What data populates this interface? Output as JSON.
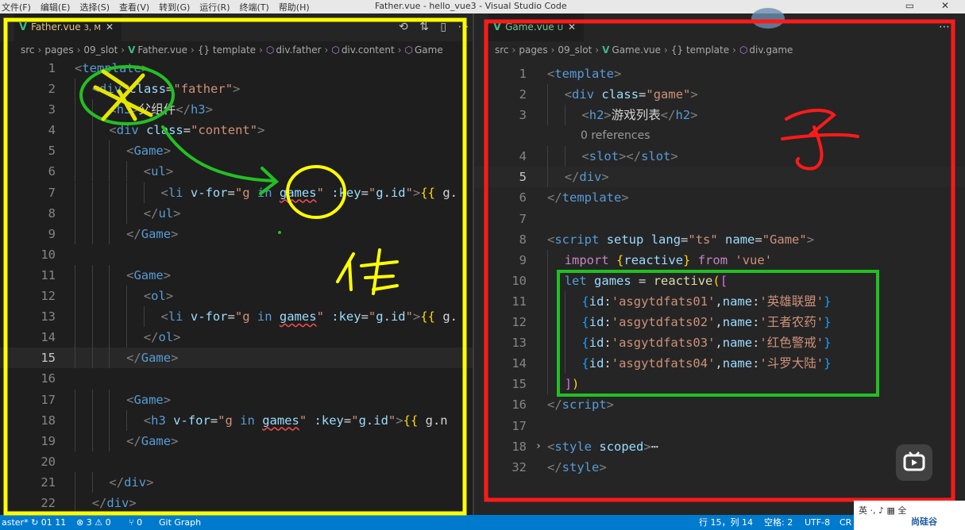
{
  "window": {
    "menu": [
      "文件(F)",
      "编辑(E)",
      "选择(S)",
      "查看(V)",
      "转到(G)",
      "运行(R)",
      "终端(T)",
      "帮助(H)"
    ],
    "title": "Father.vue - hello_vue3 - Visual Studio Code",
    "controls": [
      "▭",
      "✕"
    ]
  },
  "left": {
    "tab": {
      "name": "Father.vue",
      "status": "3, M",
      "close": "✕"
    },
    "actions": [
      "⟲",
      "⇅",
      "▯",
      "⋯"
    ],
    "breadcrumb": [
      "src",
      "pages",
      "09_slot",
      "Father.vue",
      "{} template",
      "div.father",
      "div.content",
      "Game"
    ],
    "lines": [
      {
        "n": "1",
        "tokens": [
          [
            "t-punct",
            "<"
          ],
          [
            "t-tag",
            "template"
          ],
          [
            "t-punct",
            ">"
          ]
        ],
        "indent": 0
      },
      {
        "n": "2",
        "tokens": [
          [
            "t-punct",
            "<"
          ],
          [
            "t-tag",
            "div"
          ],
          [
            "t-text",
            " "
          ],
          [
            "t-attr",
            "class"
          ],
          [
            "t-text",
            "="
          ],
          [
            "t-str",
            "\"father\""
          ],
          [
            "t-punct",
            ">"
          ]
        ],
        "indent": 1
      },
      {
        "n": "3",
        "tokens": [
          [
            "t-punct",
            "<"
          ],
          [
            "t-tag",
            "h3"
          ],
          [
            "t-punct",
            ">"
          ],
          [
            "t-text",
            "父组件"
          ],
          [
            "t-punct",
            "</"
          ],
          [
            "t-tag",
            "h3"
          ],
          [
            "t-punct",
            ">"
          ]
        ],
        "indent": 2
      },
      {
        "n": "4",
        "tokens": [
          [
            "t-punct",
            "<"
          ],
          [
            "t-tag",
            "div"
          ],
          [
            "t-text",
            " "
          ],
          [
            "t-attr",
            "class"
          ],
          [
            "t-text",
            "="
          ],
          [
            "t-str",
            "\"content\""
          ],
          [
            "t-punct",
            ">"
          ]
        ],
        "indent": 2
      },
      {
        "n": "5",
        "tokens": [
          [
            "t-punct",
            "<"
          ],
          [
            "t-tag",
            "Game"
          ],
          [
            "t-punct",
            ">"
          ]
        ],
        "indent": 3
      },
      {
        "n": "6",
        "tokens": [
          [
            "t-punct",
            "<"
          ],
          [
            "t-tag",
            "ul"
          ],
          [
            "t-punct",
            ">"
          ]
        ],
        "indent": 4
      },
      {
        "n": "7",
        "tokens": [
          [
            "t-punct",
            "<"
          ],
          [
            "t-tag",
            "li"
          ],
          [
            "t-text",
            " "
          ],
          [
            "t-attr",
            "v-for"
          ],
          [
            "t-text",
            "="
          ],
          [
            "t-str",
            "\"g "
          ],
          [
            "t-kw",
            "in"
          ],
          [
            "t-text",
            " "
          ],
          [
            "t-var t-err",
            "games"
          ],
          [
            "t-str",
            "\""
          ],
          [
            "t-text",
            " "
          ],
          [
            "t-attr",
            ":key"
          ],
          [
            "t-text",
            "="
          ],
          [
            "t-str",
            "\""
          ],
          [
            "t-var",
            "g"
          ],
          [
            "t-text",
            "."
          ],
          [
            "t-var",
            "id"
          ],
          [
            "t-str",
            "\""
          ],
          [
            "t-punct",
            ">"
          ],
          [
            "t-brace",
            "{{"
          ],
          [
            "t-text",
            " g."
          ]
        ],
        "indent": 5
      },
      {
        "n": "8",
        "tokens": [
          [
            "t-punct",
            "</"
          ],
          [
            "t-tag",
            "ul"
          ],
          [
            "t-punct",
            ">"
          ]
        ],
        "indent": 4
      },
      {
        "n": "9",
        "tokens": [
          [
            "t-punct",
            "</"
          ],
          [
            "t-tag",
            "Game"
          ],
          [
            "t-punct",
            ">"
          ]
        ],
        "indent": 3
      },
      {
        "n": "10",
        "tokens": [],
        "indent": 0
      },
      {
        "n": "11",
        "tokens": [
          [
            "t-punct",
            "<"
          ],
          [
            "t-tag",
            "Game"
          ],
          [
            "t-punct",
            ">"
          ]
        ],
        "indent": 3
      },
      {
        "n": "12",
        "tokens": [
          [
            "t-punct",
            "<"
          ],
          [
            "t-tag",
            "ol"
          ],
          [
            "t-punct",
            ">"
          ]
        ],
        "indent": 4
      },
      {
        "n": "13",
        "tokens": [
          [
            "t-punct",
            "<"
          ],
          [
            "t-tag",
            "li"
          ],
          [
            "t-text",
            " "
          ],
          [
            "t-attr",
            "v-for"
          ],
          [
            "t-text",
            "="
          ],
          [
            "t-str",
            "\"g "
          ],
          [
            "t-kw",
            "in"
          ],
          [
            "t-text",
            " "
          ],
          [
            "t-var t-err",
            "games"
          ],
          [
            "t-str",
            "\""
          ],
          [
            "t-text",
            " "
          ],
          [
            "t-attr",
            ":key"
          ],
          [
            "t-text",
            "="
          ],
          [
            "t-str",
            "\""
          ],
          [
            "t-var",
            "g"
          ],
          [
            "t-text",
            "."
          ],
          [
            "t-var",
            "id"
          ],
          [
            "t-str",
            "\""
          ],
          [
            "t-punct",
            ">"
          ],
          [
            "t-brace",
            "{{"
          ],
          [
            "t-text",
            " g."
          ]
        ],
        "indent": 5
      },
      {
        "n": "14",
        "tokens": [
          [
            "t-punct",
            "</"
          ],
          [
            "t-tag",
            "ol"
          ],
          [
            "t-punct",
            ">"
          ]
        ],
        "indent": 4
      },
      {
        "n": "15",
        "tokens": [
          [
            "t-punct",
            "</"
          ],
          [
            "t-tag",
            "Game"
          ],
          [
            "t-punct",
            ">"
          ]
        ],
        "indent": 3,
        "active": true
      },
      {
        "n": "16",
        "tokens": [],
        "indent": 0
      },
      {
        "n": "17",
        "tokens": [
          [
            "t-punct",
            "<"
          ],
          [
            "t-tag",
            "Game"
          ],
          [
            "t-punct",
            ">"
          ]
        ],
        "indent": 3
      },
      {
        "n": "18",
        "tokens": [
          [
            "t-punct",
            "<"
          ],
          [
            "t-tag",
            "h3"
          ],
          [
            "t-text",
            " "
          ],
          [
            "t-attr",
            "v-for"
          ],
          [
            "t-text",
            "="
          ],
          [
            "t-str",
            "\"g "
          ],
          [
            "t-kw",
            "in"
          ],
          [
            "t-text",
            " "
          ],
          [
            "t-var t-err",
            "games"
          ],
          [
            "t-str",
            "\""
          ],
          [
            "t-text",
            " "
          ],
          [
            "t-attr",
            ":key"
          ],
          [
            "t-text",
            "="
          ],
          [
            "t-str",
            "\""
          ],
          [
            "t-var",
            "g"
          ],
          [
            "t-text",
            "."
          ],
          [
            "t-var",
            "id"
          ],
          [
            "t-str",
            "\""
          ],
          [
            "t-punct",
            ">"
          ],
          [
            "t-brace",
            "{{"
          ],
          [
            "t-text",
            " g.n"
          ]
        ],
        "indent": 4
      },
      {
        "n": "19",
        "tokens": [
          [
            "t-punct",
            "</"
          ],
          [
            "t-tag",
            "Game"
          ],
          [
            "t-punct",
            ">"
          ]
        ],
        "indent": 3
      },
      {
        "n": "20",
        "tokens": [],
        "indent": 0
      },
      {
        "n": "21",
        "tokens": [
          [
            "t-punct",
            "</"
          ],
          [
            "t-tag",
            "div"
          ],
          [
            "t-punct",
            ">"
          ]
        ],
        "indent": 2
      },
      {
        "n": "22",
        "tokens": [
          [
            "t-punct",
            "</"
          ],
          [
            "t-tag",
            "div"
          ],
          [
            "t-punct",
            ">"
          ]
        ],
        "indent": 1
      }
    ]
  },
  "right": {
    "tab": {
      "name": "Game.vue",
      "status": "U",
      "close": "✕"
    },
    "actions": [
      "⋯"
    ],
    "breadcrumb": [
      "src",
      "pages",
      "09_slot",
      "Game.vue",
      "{} template",
      "div.game"
    ],
    "codelens": "0 references",
    "lines": [
      {
        "n": "1",
        "tokens": [
          [
            "t-punct",
            "<"
          ],
          [
            "t-tag",
            "template"
          ],
          [
            "t-punct",
            ">"
          ]
        ],
        "indent": 0
      },
      {
        "n": "2",
        "tokens": [
          [
            "t-punct",
            "<"
          ],
          [
            "t-tag",
            "div"
          ],
          [
            "t-text",
            " "
          ],
          [
            "t-attr",
            "class"
          ],
          [
            "t-text",
            "="
          ],
          [
            "t-str",
            "\"game\""
          ],
          [
            "t-punct",
            ">"
          ]
        ],
        "indent": 1
      },
      {
        "n": "3",
        "tokens": [
          [
            "t-punct",
            "<"
          ],
          [
            "t-tag",
            "h2"
          ],
          [
            "t-punct",
            ">"
          ],
          [
            "t-text",
            "游戏列表"
          ],
          [
            "t-punct",
            "</"
          ],
          [
            "t-tag",
            "h2"
          ],
          [
            "t-punct",
            ">"
          ]
        ],
        "indent": 2
      },
      {
        "n": "4",
        "tokens": [
          [
            "t-punct",
            "<"
          ],
          [
            "t-tag",
            "slot"
          ],
          [
            "t-punct",
            "></"
          ],
          [
            "t-tag",
            "slot"
          ],
          [
            "t-punct",
            ">"
          ]
        ],
        "indent": 2
      },
      {
        "n": "5",
        "tokens": [
          [
            "t-punct",
            "</"
          ],
          [
            "t-tag",
            "div"
          ],
          [
            "t-punct",
            ">"
          ]
        ],
        "indent": 1,
        "active": true
      },
      {
        "n": "6",
        "tokens": [
          [
            "t-punct",
            "</"
          ],
          [
            "t-tag",
            "template"
          ],
          [
            "t-punct",
            ">"
          ]
        ],
        "indent": 0
      },
      {
        "n": "7",
        "tokens": [],
        "indent": 0
      },
      {
        "n": "8",
        "tokens": [
          [
            "t-punct",
            "<"
          ],
          [
            "t-tag",
            "script"
          ],
          [
            "t-text",
            " "
          ],
          [
            "t-attr",
            "setup"
          ],
          [
            "t-text",
            " "
          ],
          [
            "t-attr",
            "lang"
          ],
          [
            "t-text",
            "="
          ],
          [
            "t-str",
            "\"ts\""
          ],
          [
            "t-text",
            " "
          ],
          [
            "t-attr",
            "name"
          ],
          [
            "t-text",
            "="
          ],
          [
            "t-str",
            "\"Game\""
          ],
          [
            "t-punct",
            ">"
          ]
        ],
        "indent": 0
      },
      {
        "n": "9",
        "tokens": [
          [
            "t-imp",
            "import"
          ],
          [
            "t-text",
            " "
          ],
          [
            "t-brace",
            "{"
          ],
          [
            "t-var",
            "reactive"
          ],
          [
            "t-brace",
            "}"
          ],
          [
            "t-text",
            " "
          ],
          [
            "t-imp",
            "from"
          ],
          [
            "t-text",
            " "
          ],
          [
            "t-str",
            "'vue'"
          ]
        ],
        "indent": 1
      },
      {
        "n": "10",
        "tokens": [
          [
            "t-kw",
            "let"
          ],
          [
            "t-text",
            " "
          ],
          [
            "t-var",
            "games"
          ],
          [
            "t-text",
            " = "
          ],
          [
            "t-fn",
            "reactive"
          ],
          [
            "t-brace",
            "("
          ],
          [
            "t-bracket",
            "["
          ]
        ],
        "indent": 1
      },
      {
        "n": "11",
        "tokens": [
          [
            "t-brace2",
            "{"
          ],
          [
            "t-var",
            "id"
          ],
          [
            "t-text",
            ":"
          ],
          [
            "t-str",
            "'asgytdfats01'"
          ],
          [
            "t-text",
            ","
          ],
          [
            "t-var",
            "name"
          ],
          [
            "t-text",
            ":"
          ],
          [
            "t-str",
            "'英雄联盟'"
          ],
          [
            "t-brace2",
            "}"
          ]
        ],
        "indent": 2
      },
      {
        "n": "12",
        "tokens": [
          [
            "t-brace2",
            "{"
          ],
          [
            "t-var",
            "id"
          ],
          [
            "t-text",
            ":"
          ],
          [
            "t-str",
            "'asgytdfats02'"
          ],
          [
            "t-text",
            ","
          ],
          [
            "t-var",
            "name"
          ],
          [
            "t-text",
            ":"
          ],
          [
            "t-str",
            "'王者农药'"
          ],
          [
            "t-brace2",
            "}"
          ]
        ],
        "indent": 2
      },
      {
        "n": "13",
        "tokens": [
          [
            "t-brace2",
            "{"
          ],
          [
            "t-var",
            "id"
          ],
          [
            "t-text",
            ":"
          ],
          [
            "t-str",
            "'asgytdfats03'"
          ],
          [
            "t-text",
            ","
          ],
          [
            "t-var",
            "name"
          ],
          [
            "t-text",
            ":"
          ],
          [
            "t-str",
            "'红色警戒'"
          ],
          [
            "t-brace2",
            "}"
          ]
        ],
        "indent": 2
      },
      {
        "n": "14",
        "tokens": [
          [
            "t-brace2",
            "{"
          ],
          [
            "t-var",
            "id"
          ],
          [
            "t-text",
            ":"
          ],
          [
            "t-str",
            "'asgytdfats04'"
          ],
          [
            "t-text",
            ","
          ],
          [
            "t-var",
            "name"
          ],
          [
            "t-text",
            ":"
          ],
          [
            "t-str",
            "'斗罗大陆'"
          ],
          [
            "t-brace2",
            "}"
          ]
        ],
        "indent": 2
      },
      {
        "n": "15",
        "tokens": [
          [
            "t-bracket",
            "]"
          ],
          [
            "t-brace",
            ")"
          ]
        ],
        "indent": 1
      },
      {
        "n": "16",
        "tokens": [
          [
            "t-punct",
            "</"
          ],
          [
            "t-tag",
            "script"
          ],
          [
            "t-punct",
            ">"
          ]
        ],
        "indent": 0
      },
      {
        "n": "17",
        "tokens": [],
        "indent": 0
      },
      {
        "n": "18",
        "tokens": [
          [
            "t-punct",
            "<"
          ],
          [
            "t-tag",
            "style"
          ],
          [
            "t-text",
            " "
          ],
          [
            "t-attr",
            "scoped"
          ],
          [
            "t-punct",
            ">"
          ],
          [
            "t-text",
            "⋯"
          ]
        ],
        "indent": 0,
        "fold": "›"
      },
      {
        "n": "32",
        "tokens": [
          [
            "t-punct",
            "</"
          ],
          [
            "t-tag",
            "style"
          ],
          [
            "t-punct",
            ">"
          ]
        ],
        "indent": 0
      }
    ]
  },
  "statusbar": {
    "branch": "aster* ↻ 01 11",
    "problems": "⊗ 3 ⚠ 0",
    "ports": "⑂ 0",
    "git_graph": "Git Graph",
    "position": "行 15，列 14",
    "spaces": "空格: 2",
    "encoding": "UTF-8",
    "eol": "CR"
  },
  "watermark": {
    "a": "英 ·, ♪ ▦ 全",
    "b": "尚硅谷"
  },
  "colors": {
    "yellow_frame": "#ffff00",
    "red_frame": "#ff1a1a",
    "green_frame": "#22c022",
    "vue": "#41b883"
  }
}
